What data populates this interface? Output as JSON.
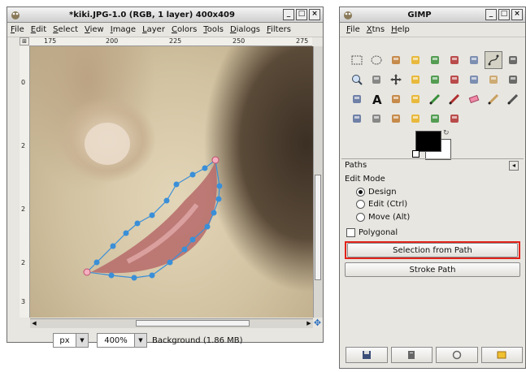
{
  "image_window": {
    "title": "*kiki.JPG-1.0 (RGB, 1 layer) 400x409",
    "menu": [
      "File",
      "Edit",
      "Select",
      "View",
      "Image",
      "Layer",
      "Colors",
      "Tools",
      "Dialogs",
      "Filters"
    ],
    "hruler_ticks": [
      "175",
      "200",
      "225",
      "250",
      "275"
    ],
    "vruler_ticks": [
      "0",
      "2",
      "2",
      "2",
      "3"
    ],
    "status": {
      "unit": "px",
      "zoom": "400%",
      "layer_info": "Background (1.86 MB)"
    }
  },
  "toolbox": {
    "title": "GIMP",
    "menu": [
      "File",
      "Xtns",
      "Help"
    ],
    "tools": [
      "rect-select-icon",
      "ellipse-select-icon",
      "free-select-icon",
      "fuzzy-select-icon",
      "color-select-icon",
      "scissors-icon",
      "foreground-select-icon",
      "paths-icon",
      "color-picker-icon",
      "magnify-icon",
      "measure-icon",
      "move-icon",
      "align-icon",
      "crop-icon",
      "rotate-icon",
      "scale-icon",
      "shear-icon",
      "perspective-icon",
      "flip-icon",
      "text-icon",
      "bucket-fill-icon",
      "blend-icon",
      "pencil-icon",
      "paintbrush-icon",
      "eraser-icon",
      "airbrush-icon",
      "ink-icon",
      "clone-icon",
      "heal-icon",
      "perspective-clone-icon",
      "blur-icon",
      "smudge-icon",
      "dodge-burn-icon"
    ],
    "colors": {
      "foreground": "#000000",
      "background": "#ffffff",
      "highlight": "#e2231a"
    },
    "paths": {
      "section_title": "Paths",
      "edit_mode_label": "Edit Mode",
      "modes": [
        {
          "label": "Design",
          "selected": true
        },
        {
          "label": "Edit (Ctrl)",
          "selected": false
        },
        {
          "label": "Move (Alt)",
          "selected": false
        }
      ],
      "polygonal_label": "Polygonal",
      "selection_from_path": "Selection from Path",
      "stroke_path": "Stroke Path"
    },
    "bottom_buttons": [
      "save-options-icon",
      "restore-options-icon",
      "delete-options-icon",
      "reset-options-icon"
    ]
  }
}
